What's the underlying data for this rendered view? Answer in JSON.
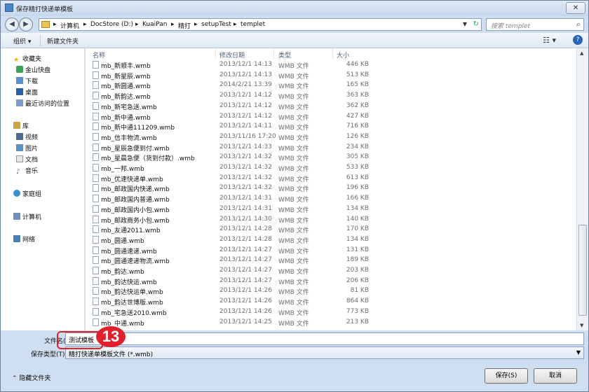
{
  "window": {
    "title": "保存精打快递单模板"
  },
  "nav": {
    "path": [
      "计算机",
      "DocStore (D:)",
      "KuaiPan",
      "精打",
      "setupTest",
      "templet"
    ],
    "search_placeholder": "搜索 templet"
  },
  "toolbar": {
    "organize": "组织 ▾",
    "new_folder": "新建文件夹"
  },
  "sidebar": {
    "favorites_label": "收藏夹",
    "favorites": [
      "金山快盘",
      "下载",
      "桌面",
      "最近访问的位置"
    ],
    "library_label": "库",
    "library": [
      "视频",
      "图片",
      "文档",
      "音乐"
    ],
    "homegroup": "家庭组",
    "computer": "计算机",
    "network": "网络"
  },
  "columns": {
    "name": "名称",
    "date": "修改日期",
    "type": "类型",
    "size": "大小"
  },
  "files": [
    {
      "name": "mb_新顺丰.wmb",
      "date": "2013/12/1 14:13",
      "type": "WMB 文件",
      "size": "446 KB"
    },
    {
      "name": "mb_新星辰.wmb",
      "date": "2013/12/1 14:13",
      "type": "WMB 文件",
      "size": "513 KB"
    },
    {
      "name": "mb_新圆通.wmb",
      "date": "2014/2/21 13:39",
      "type": "WMB 文件",
      "size": "165 KB"
    },
    {
      "name": "mb_新韵达.wmb",
      "date": "2013/12/1 14:12",
      "type": "WMB 文件",
      "size": "363 KB"
    },
    {
      "name": "mb_新宅急送.wmb",
      "date": "2013/12/1 14:12",
      "type": "WMB 文件",
      "size": "362 KB"
    },
    {
      "name": "mb_新中通.wmb",
      "date": "2013/12/1 14:12",
      "type": "WMB 文件",
      "size": "427 KB"
    },
    {
      "name": "mb_新中通111209.wmb",
      "date": "2013/12/1 14:11",
      "type": "WMB 文件",
      "size": "716 KB"
    },
    {
      "name": "mb_信丰物流.wmb",
      "date": "2013/11/16 17:20",
      "type": "WMB 文件",
      "size": "126 KB"
    },
    {
      "name": "mb_星辰急便到付.wmb",
      "date": "2013/12/1 14:33",
      "type": "WMB 文件",
      "size": "234 KB"
    },
    {
      "name": "mb_星晨急便（货到付款）.wmb",
      "date": "2013/12/1 14:32",
      "type": "WMB 文件",
      "size": "305 KB"
    },
    {
      "name": "mb_一邦.wmb",
      "date": "2013/12/1 14:32",
      "type": "WMB 文件",
      "size": "533 KB"
    },
    {
      "name": "mb_优速快递单.wmb",
      "date": "2013/12/1 14:32",
      "type": "WMB 文件",
      "size": "613 KB"
    },
    {
      "name": "mb_邮政国内快递.wmb",
      "date": "2013/12/1 14:32",
      "type": "WMB 文件",
      "size": "196 KB"
    },
    {
      "name": "mb_邮政国内普通.wmb",
      "date": "2013/12/1 14:31",
      "type": "WMB 文件",
      "size": "166 KB"
    },
    {
      "name": "mb_邮政国内小包.wmb",
      "date": "2013/12/1 14:31",
      "type": "WMB 文件",
      "size": "134 KB"
    },
    {
      "name": "mb_邮政商务小包.wmb",
      "date": "2013/12/1 14:30",
      "type": "WMB 文件",
      "size": "140 KB"
    },
    {
      "name": "mb_友通2011.wmb",
      "date": "2013/12/1 14:28",
      "type": "WMB 文件",
      "size": "170 KB"
    },
    {
      "name": "mb_圆通.wmb",
      "date": "2013/12/1 14:28",
      "type": "WMB 文件",
      "size": "134 KB"
    },
    {
      "name": "mb_圆通速递.wmb",
      "date": "2013/12/1 14:27",
      "type": "WMB 文件",
      "size": "131 KB"
    },
    {
      "name": "mb_圆通速递物流.wmb",
      "date": "2013/12/1 14:27",
      "type": "WMB 文件",
      "size": "189 KB"
    },
    {
      "name": "mb_韵达.wmb",
      "date": "2013/12/1 14:27",
      "type": "WMB 文件",
      "size": "203 KB"
    },
    {
      "name": "mb_韵达快运.wmb",
      "date": "2013/12/1 14:27",
      "type": "WMB 文件",
      "size": "206 KB"
    },
    {
      "name": "mb_韵达快运单.wmb",
      "date": "2013/12/1 14:26",
      "type": "WMB 文件",
      "size": "81 KB"
    },
    {
      "name": "mb_韵达世博版.wmb",
      "date": "2013/12/1 14:26",
      "type": "WMB 文件",
      "size": "864 KB"
    },
    {
      "name": "mb_宅急送2010.wmb",
      "date": "2013/12/1 14:26",
      "type": "WMB 文件",
      "size": "773 KB"
    },
    {
      "name": "mb_中通.wmb",
      "date": "2013/12/1 14:25",
      "type": "WMB 文件",
      "size": "213 KB"
    }
  ],
  "form": {
    "filename_label": "文件名(N):",
    "filename_value": "测试模板",
    "filetype_label": "保存类型(T):",
    "filetype_value": "精打快递单模板文件 (*.wmb)"
  },
  "footer": {
    "hide_folders": "隐藏文件夹",
    "save": "保存(S)",
    "cancel": "取消"
  },
  "annotation": {
    "badge": "13",
    "color": "#e0202a"
  }
}
